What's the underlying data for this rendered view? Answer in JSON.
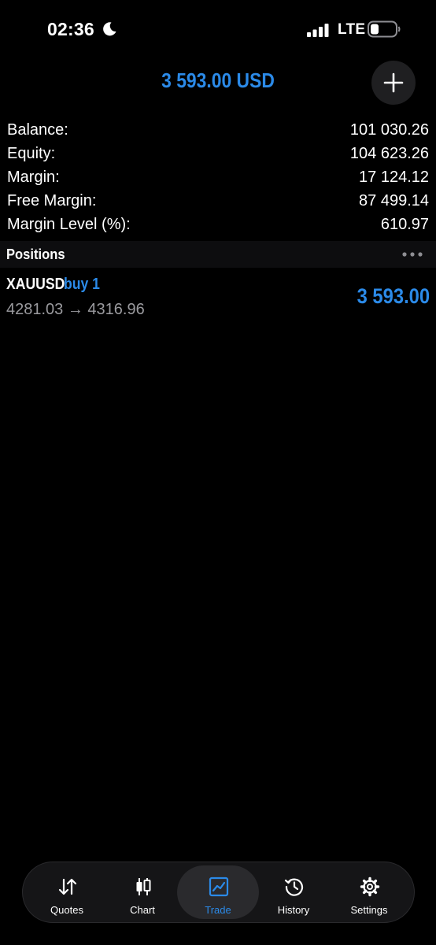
{
  "status_bar": {
    "time": "02:36",
    "network": "LTE",
    "icons": [
      "moon-icon",
      "signal-icon",
      "battery-icon"
    ]
  },
  "header": {
    "balance_display": "3 593.00 USD",
    "add_button_icon": "plus-icon"
  },
  "account": {
    "rows": [
      {
        "label": "Balance:",
        "value": "101 030.26"
      },
      {
        "label": "Equity:",
        "value": "104 623.26"
      },
      {
        "label": "Margin:",
        "value": "17 124.12"
      },
      {
        "label": "Free Margin:",
        "value": "87 499.14"
      },
      {
        "label": "Margin Level (%):",
        "value": "610.97"
      }
    ]
  },
  "positions": {
    "title": "Positions",
    "menu_icon": "more-dots-icon",
    "items": [
      {
        "symbol": "XAUUSD",
        "type": "buy 1",
        "prices": "4281.03 → 4316.96",
        "profit": "3 593.00"
      }
    ]
  },
  "tab_bar": {
    "active": "Trade",
    "tabs": [
      {
        "label": "Quotes",
        "icon": "quotes-arrows-icon"
      },
      {
        "label": "Chart",
        "icon": "candlestick-icon"
      },
      {
        "label": "Trade",
        "icon": "trade-chart-icon"
      },
      {
        "label": "History",
        "icon": "history-clock-icon"
      },
      {
        "label": "Settings",
        "icon": "gear-icon"
      }
    ]
  },
  "colors": {
    "accent": "#2b8ae8",
    "background": "#000000",
    "secondary_text": "#9a9a9e"
  }
}
